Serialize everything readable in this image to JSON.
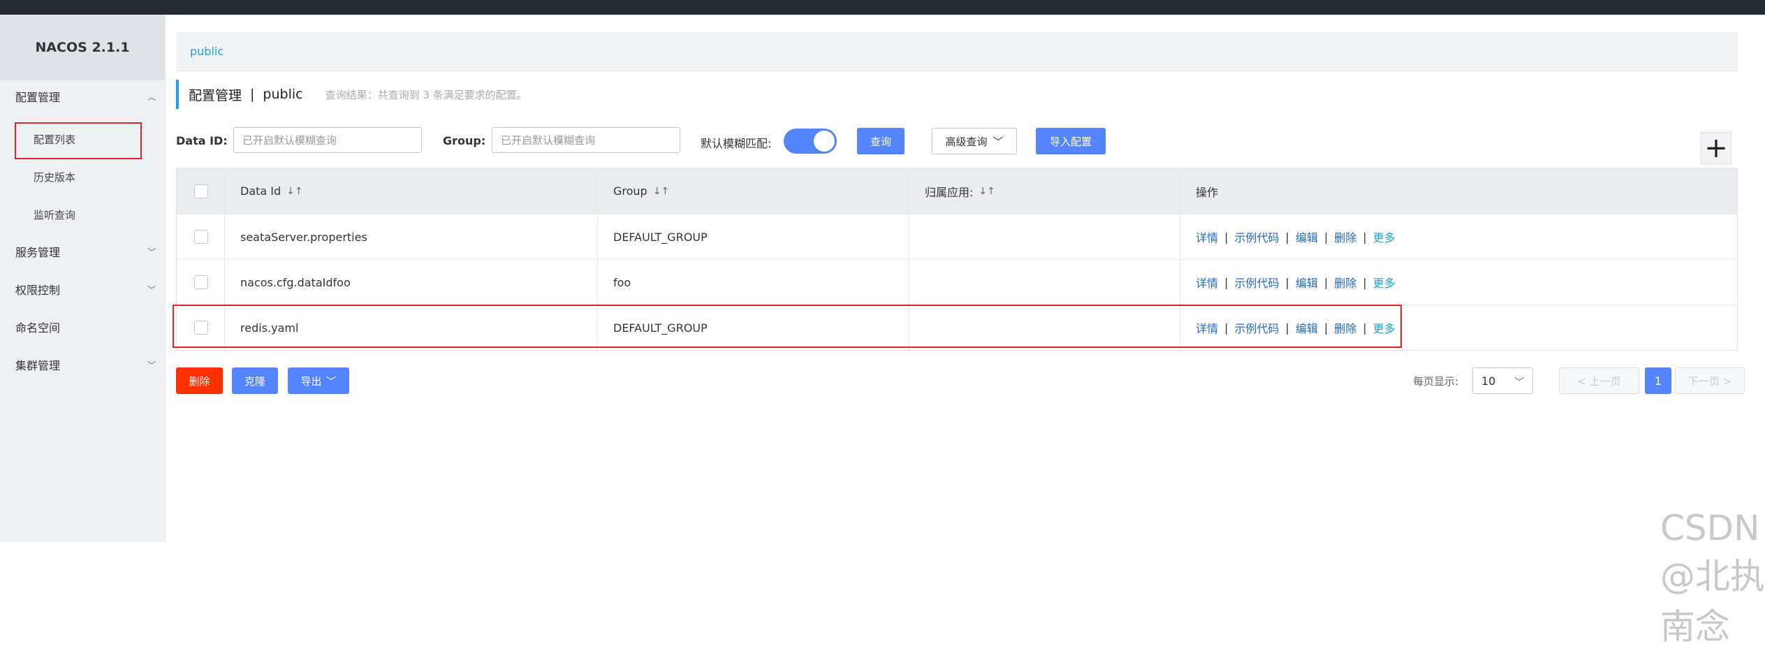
{
  "app": {
    "brand": "NACOS 2.1.1"
  },
  "sidebar": {
    "groups": [
      {
        "label": "配置管理",
        "chevron": "^"
      },
      {
        "label": "服务管理",
        "chevron": "v"
      },
      {
        "label": "权限控制",
        "chevron": "v"
      },
      {
        "label": "命名空间"
      },
      {
        "label": "集群管理",
        "chevron": "v"
      }
    ],
    "items": [
      "配置列表",
      "历史版本",
      "监听查询"
    ]
  },
  "breadcrumb": {
    "namespace": "public"
  },
  "header": {
    "title": "配置管理",
    "separator": "|",
    "namespace": "public",
    "hint": "查询结果：共查询到 3 条满足要求的配置。"
  },
  "filters": {
    "dataid_label": "Data ID:",
    "dataid_placeholder": "已开启默认模糊查询",
    "group_label": "Group:",
    "group_placeholder": "已开启默认模糊查询",
    "fuzzy_label": "默认模糊匹配:",
    "fuzzy_on": true,
    "query_button": "查询",
    "advanced_button": "高级查询",
    "import_button": "导入配置",
    "add_button": "+"
  },
  "table": {
    "headers": [
      "Data Id",
      "Group",
      "归属应用:",
      "操作"
    ],
    "rows": [
      {
        "data_id": "seataServer.properties",
        "group": "DEFAULT_GROUP",
        "app": ""
      },
      {
        "data_id": "nacos.cfg.dataIdfoo",
        "group": "foo",
        "app": ""
      },
      {
        "data_id": "redis.yaml",
        "group": "DEFAULT_GROUP",
        "app": ""
      }
    ],
    "ops": {
      "detail": "详情",
      "sample": "示例代码",
      "edit": "编辑",
      "delete": "删除",
      "more": "更多"
    }
  },
  "bulk": {
    "delete": "删除",
    "clone": "克隆",
    "export": "导出"
  },
  "pagination": {
    "page_size_label": "每页显示:",
    "page_size": "10",
    "prev": "< 上一页",
    "current": "1",
    "next": "下一页 >"
  },
  "watermark": "CSDN @北执南念",
  "colors": {
    "primary": "#5584ff",
    "danger": "#ff3000",
    "link": "#1f69c9",
    "highlight": "#e0222a"
  }
}
